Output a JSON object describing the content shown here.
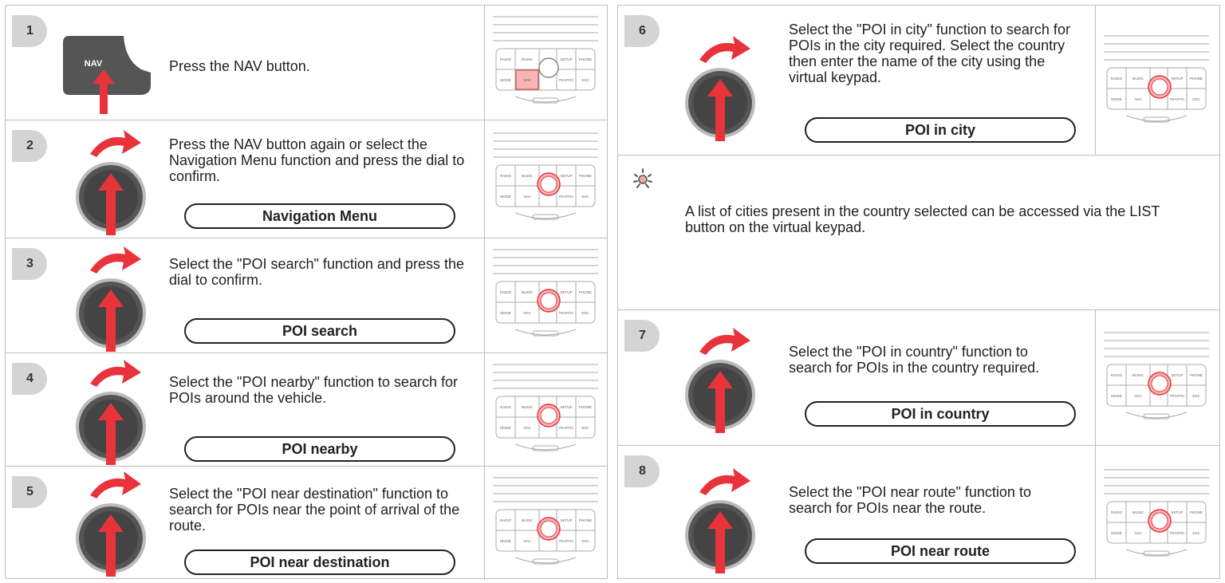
{
  "left_steps": [
    {
      "num": "1",
      "text": "Press the NAV button.",
      "pill": null
    },
    {
      "num": "2",
      "text": "Press the NAV button again or select the Navigation Menu function and press the dial to confirm.",
      "pill": "Navigation Menu"
    },
    {
      "num": "3",
      "text": "Select the \"POI search\" function and press the dial to confirm.",
      "pill": "POI search"
    },
    {
      "num": "4",
      "text": "Select the \"POI nearby\" function to search for POIs around the vehicle.",
      "pill": "POI nearby"
    },
    {
      "num": "5",
      "text": "Select the \"POI near destination\" function to search for POIs near the point of arrival of the route.",
      "pill": "POI near destination"
    }
  ],
  "right_steps": [
    {
      "num": "6",
      "text": "Select the \"POI in city\" function to search for POIs in the city required. Select the country then enter the name of the city using the virtual keypad.",
      "pill": "POI in city"
    },
    {
      "num": "7",
      "text": "Select the \"POI in country\" function to search for POIs in the country required.",
      "pill": "POI in country"
    },
    {
      "num": "8",
      "text": "Select the \"POI near route\" function to search for POIs near the route.",
      "pill": "POI near route"
    }
  ],
  "tip": {
    "text": "A list of cities present in the country selected can be accessed via the LIST button on the virtual keypad.",
    "icon": "lightbulb-icon"
  },
  "nav_key_label": "NAV",
  "console_labels": {
    "radio": "RADIO",
    "music": "MUSIC",
    "setup": "SETUP",
    "phone": "PHONE",
    "mode": "MODE",
    "nav": "NAV",
    "traffic": "TRAFFIC",
    "esc": "ESC"
  },
  "colors": {
    "accent": "#e8333b",
    "highlight": "#f5b5b5",
    "badge": "#d4d4d4",
    "border": "#bdbdbd"
  }
}
